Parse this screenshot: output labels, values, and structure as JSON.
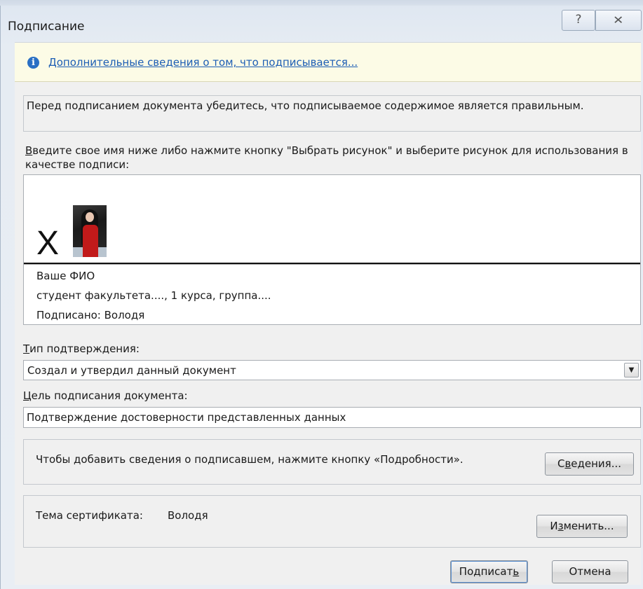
{
  "window": {
    "title": "Подписание",
    "help_glyph": "?",
    "close_glyph": "✕"
  },
  "info_bar": {
    "icon": "info-icon",
    "link_text": "Дополнительные сведения о том, что подписывается..."
  },
  "verify_text": "Перед подписанием документа убедитесь, что подписываемое содержимое является правильным.",
  "prompt": {
    "accel": "В",
    "rest": "ведите свое имя ниже либо нажмите кнопку \"Выбрать рисунок\" и выберите рисунок для использования в качестве подписи:"
  },
  "signature": {
    "x_mark": "X",
    "name": "Ваше ФИО",
    "title": "студент факультета...., 1 курса, группа....",
    "signed_by": "Подписано: Володя"
  },
  "commitment": {
    "label_accel": "Т",
    "label_rest": "ип подтверждения:",
    "selected": "Создал и утвердил данный документ",
    "arrow": "▼"
  },
  "purpose": {
    "label_accel": "Ц",
    "label_rest": "ель подписания документа:",
    "value": "Подтверждение достоверности представленных данных"
  },
  "details": {
    "text": "Чтобы добавить сведения о подписавшем, нажмите кнопку «Подробности».",
    "button_accel": "в",
    "button_pre": "С",
    "button_post": "едения..."
  },
  "certificate": {
    "label": "Тема сертификата:",
    "value": "Володя",
    "button_pre": "И",
    "button_accel": "з",
    "button_post": "менить..."
  },
  "footer": {
    "sign_pre": "Подписат",
    "sign_accel": "ь",
    "cancel": "Отмена"
  },
  "colors": {
    "info_bar_bg": "#fcfbe6",
    "link": "#1c5db4",
    "info_icon": "#2a6fc4"
  }
}
